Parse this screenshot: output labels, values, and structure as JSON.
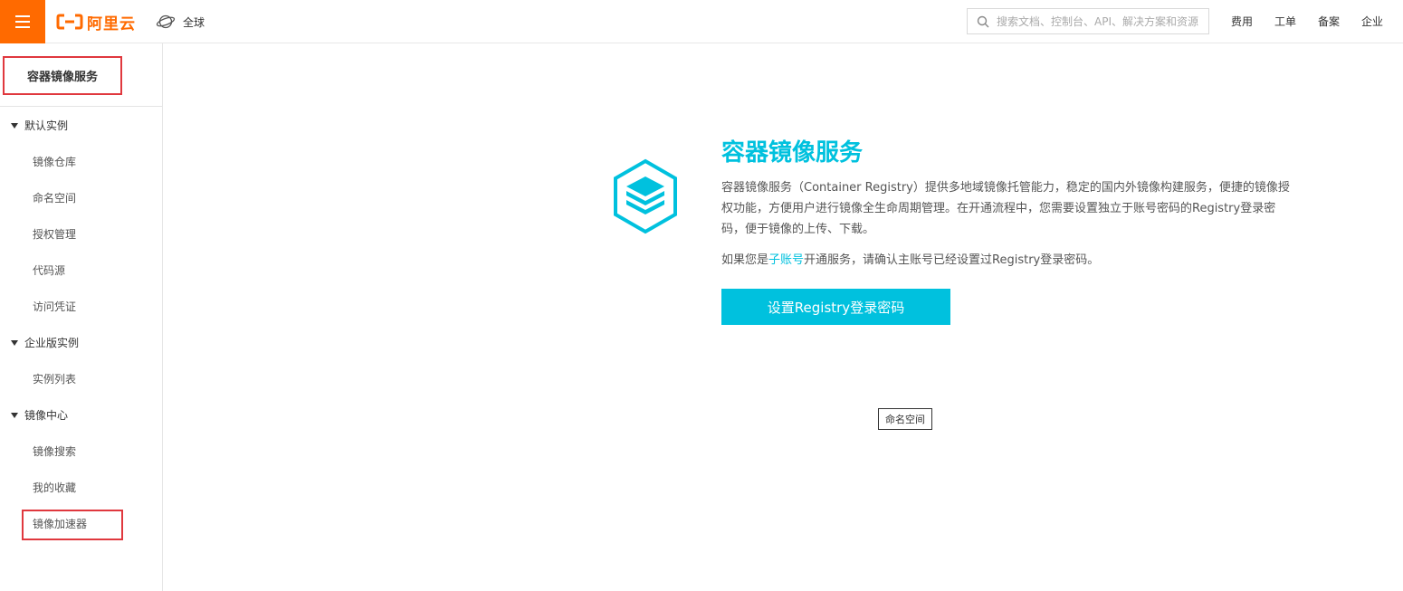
{
  "header": {
    "logo_text": "阿里云",
    "region_label": "全球",
    "search_placeholder": "搜索文档、控制台、API、解决方案和资源",
    "links": [
      "费用",
      "工单",
      "备案",
      "企业"
    ]
  },
  "sidebar": {
    "title": "容器镜像服务",
    "groups": [
      {
        "label": "默认实例",
        "items": [
          "镜像仓库",
          "命名空间",
          "授权管理",
          "代码源",
          "访问凭证"
        ]
      },
      {
        "label": "企业版实例",
        "items": [
          "实例列表"
        ]
      },
      {
        "label": "镜像中心",
        "items": [
          "镜像搜索",
          "我的收藏",
          "镜像加速器"
        ]
      }
    ]
  },
  "main": {
    "title": "容器镜像服务",
    "description": "容器镜像服务（Container Registry）提供多地域镜像托管能力，稳定的国内外镜像构建服务，便捷的镜像授权功能，方便用户进行镜像全生命周期管理。在开通流程中，您需要设置独立于账号密码的Registry登录密码，便于镜像的上传、下载。",
    "note_prefix": "如果您是",
    "note_link": "子账号",
    "note_suffix": "开通服务，请确认主账号已经设置过Registry登录密码。",
    "button_label": "设置Registry登录密码",
    "tooltip": "命名空间"
  },
  "colors": {
    "brand_orange": "#ff6a00",
    "accent_cyan": "#00c1de",
    "highlight_red": "#e0383e"
  }
}
